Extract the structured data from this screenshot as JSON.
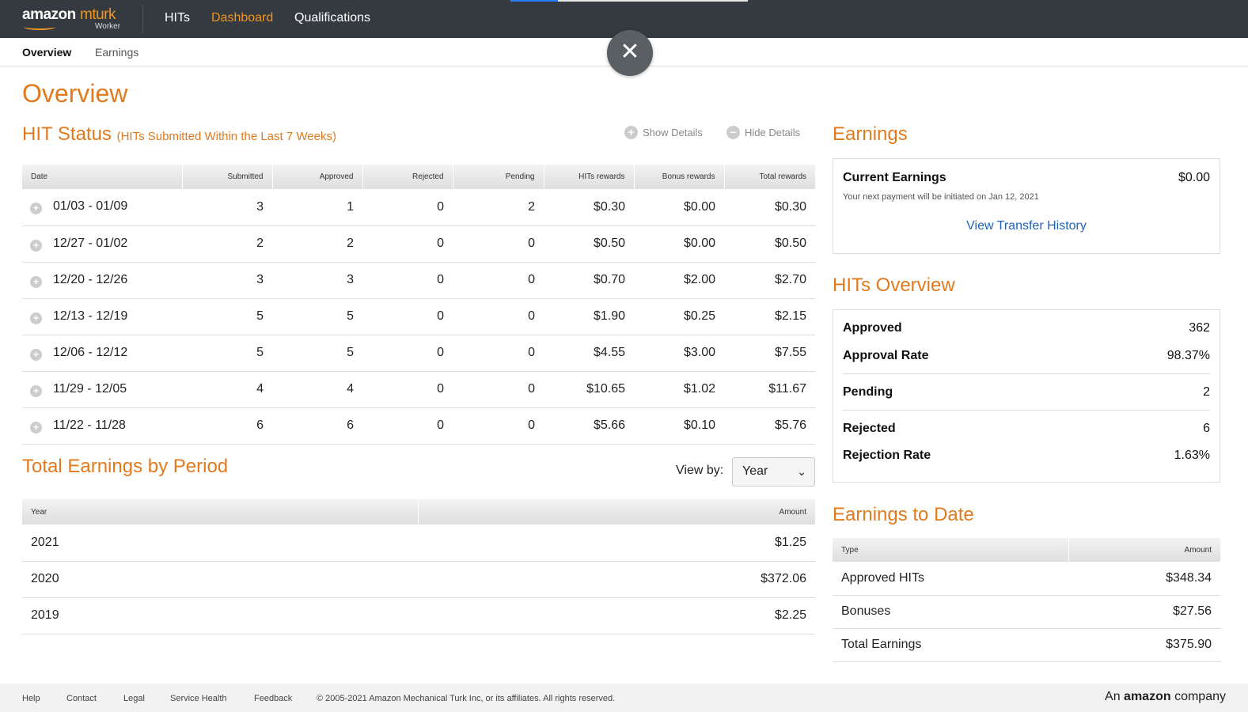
{
  "brand": {
    "name_a": "amazon",
    "name_b": "mturk",
    "sub": "Worker"
  },
  "nav": {
    "hits": "HITs",
    "dashboard": "Dashboard",
    "qualifications": "Qualifications"
  },
  "subnav": {
    "overview": "Overview",
    "earnings": "Earnings"
  },
  "close_label": "✕",
  "page_title": "Overview",
  "hit_status": {
    "title": "HIT Status",
    "subtitle": "(HITs Submitted Within the Last 7 Weeks)",
    "show_details": "Show Details",
    "hide_details": "Hide Details",
    "columns": [
      "Date",
      "Submitted",
      "Approved",
      "Rejected",
      "Pending",
      "HITs rewards",
      "Bonus rewards",
      "Total rewards"
    ],
    "rows": [
      [
        "01/03 - 01/09",
        "3",
        "1",
        "0",
        "2",
        "$0.30",
        "$0.00",
        "$0.30"
      ],
      [
        "12/27 - 01/02",
        "2",
        "2",
        "0",
        "0",
        "$0.50",
        "$0.00",
        "$0.50"
      ],
      [
        "12/20 - 12/26",
        "3",
        "3",
        "0",
        "0",
        "$0.70",
        "$2.00",
        "$2.70"
      ],
      [
        "12/13 - 12/19",
        "5",
        "5",
        "0",
        "0",
        "$1.90",
        "$0.25",
        "$2.15"
      ],
      [
        "12/06 - 12/12",
        "5",
        "5",
        "0",
        "0",
        "$4.55",
        "$3.00",
        "$7.55"
      ],
      [
        "11/29 - 12/05",
        "4",
        "4",
        "0",
        "0",
        "$10.65",
        "$1.02",
        "$11.67"
      ],
      [
        "11/22 - 11/28",
        "6",
        "6",
        "0",
        "0",
        "$5.66",
        "$0.10",
        "$5.76"
      ]
    ]
  },
  "period": {
    "title": "Total Earnings by Period",
    "view_by_label": "View by:",
    "view_by_value": "Year",
    "columns": [
      "Year",
      "Amount"
    ],
    "rows": [
      [
        "2021",
        "$1.25"
      ],
      [
        "2020",
        "$372.06"
      ],
      [
        "2019",
        "$2.25"
      ]
    ]
  },
  "earnings": {
    "title": "Earnings",
    "current_label": "Current Earnings",
    "current_value": "$0.00",
    "note": "Your next payment will be initiated on Jan 12, 2021",
    "link": "View Transfer History"
  },
  "hits_overview": {
    "title": "HITs Overview",
    "approved_label": "Approved",
    "approved_value": "362",
    "approval_rate_label": "Approval Rate",
    "approval_rate_value": "98.37%",
    "pending_label": "Pending",
    "pending_value": "2",
    "rejected_label": "Rejected",
    "rejected_value": "6",
    "rejection_rate_label": "Rejection Rate",
    "rejection_rate_value": "1.63%"
  },
  "earnings_to_date": {
    "title": "Earnings to Date",
    "columns": [
      "Type",
      "Amount"
    ],
    "rows": [
      [
        "Approved HITs",
        "$348.34"
      ],
      [
        "Bonuses",
        "$27.56"
      ],
      [
        "Total Earnings",
        "$375.90"
      ]
    ]
  },
  "footer": {
    "help": "Help",
    "contact": "Contact",
    "legal": "Legal",
    "service_health": "Service Health",
    "feedback": "Feedback",
    "copyright": "© 2005-2021 Amazon Mechanical Turk Inc, or its affiliates. All rights reserved.",
    "company_pre": "An",
    "company_brand": "amazon",
    "company_post": "company"
  },
  "colors": {
    "accent": "#e17a1e",
    "nav_bg": "#343a40",
    "link": "#1f64b4"
  }
}
